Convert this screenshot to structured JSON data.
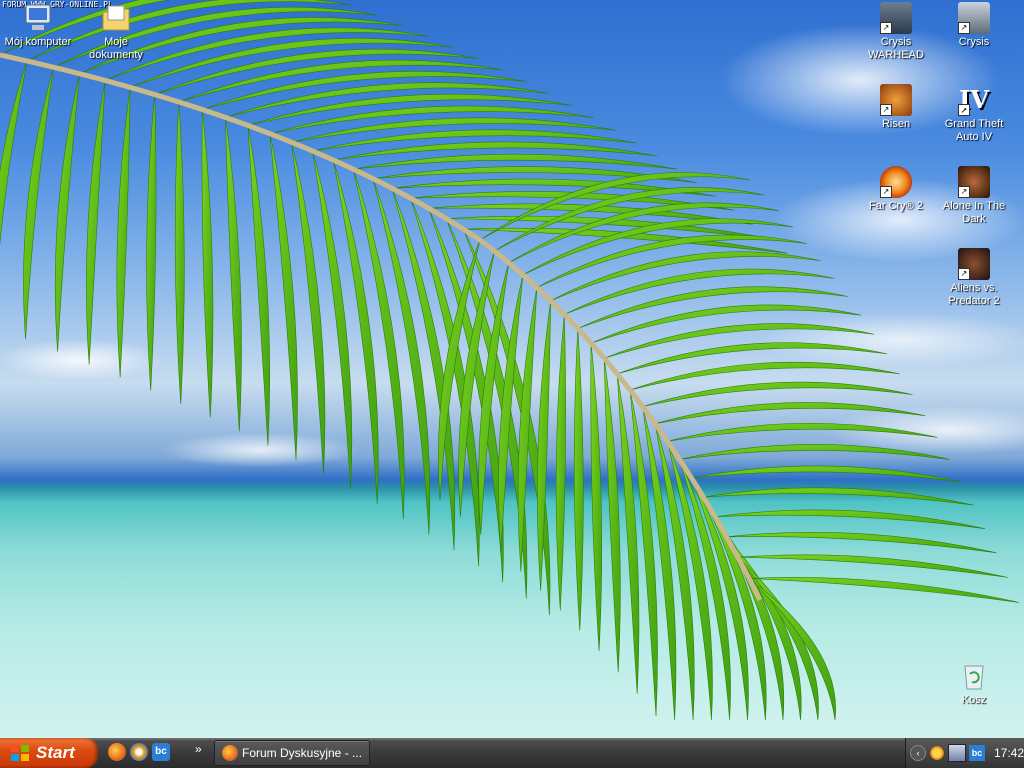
{
  "watermark": "FORUM WWW.GRY-ONLINE.PL",
  "desktop_icons": {
    "my_computer": "Mój komputer",
    "my_documents": "Moje dokumenty",
    "crysis_warhead": "Crysis WARHEAD",
    "crysis": "Crysis",
    "risen": "Risen",
    "gta4": "Grand Theft Auto IV",
    "far_cry2": "Far Cry® 2",
    "alone_in_the_dark": "Alone In The Dark",
    "aliens_vs_predator2": "Aliens vs. Predator 2",
    "recycle_bin": "Kosz"
  },
  "taskbar": {
    "start_label": "Start",
    "quick_launch_more": "»",
    "task_title": "Forum Dyskusyjne - ...",
    "tray_expand": "‹",
    "clock": "17:42"
  },
  "colors": {
    "start_button": "#de4b10",
    "taskbar": "#3a3a3a",
    "palm_leaf": "#5cbf1a"
  },
  "icons": {
    "quick_launch": [
      "firefox-icon",
      "media-player-icon",
      "bc-icon"
    ],
    "tray": [
      "sun-icon",
      "network-icon",
      "bc-icon"
    ]
  }
}
